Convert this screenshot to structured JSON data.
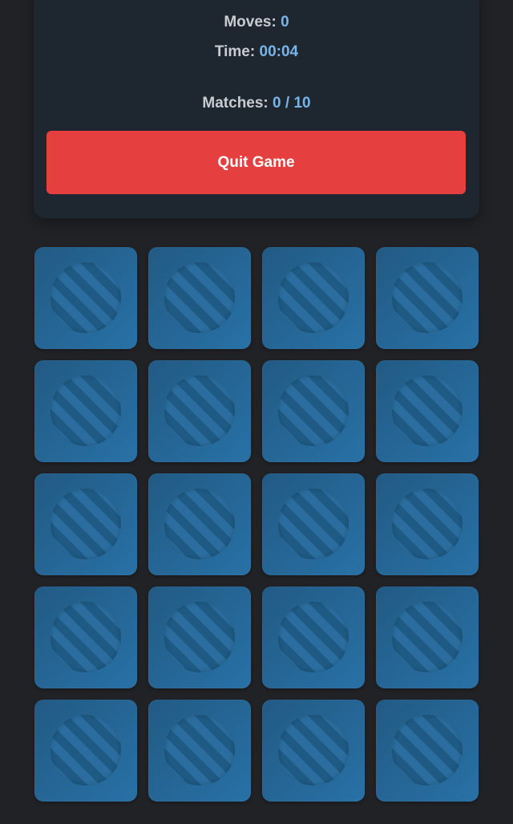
{
  "stats": {
    "moves_label": "Moves:",
    "moves_value": "0",
    "time_label": "Time:",
    "time_value": "00:04",
    "matches_label": "Matches:",
    "matches_value": "0 / 10"
  },
  "actions": {
    "quit_label": "Quit Game"
  },
  "board": {
    "rows": 5,
    "columns": 4,
    "card_state": "face-down",
    "card_back_icon": "striped-circle-icon"
  },
  "colors": {
    "background": "#212226",
    "panel": "#1e2630",
    "accent_value": "#79b4e8",
    "quit_button": "#e63f40",
    "card": "#2871a6"
  }
}
